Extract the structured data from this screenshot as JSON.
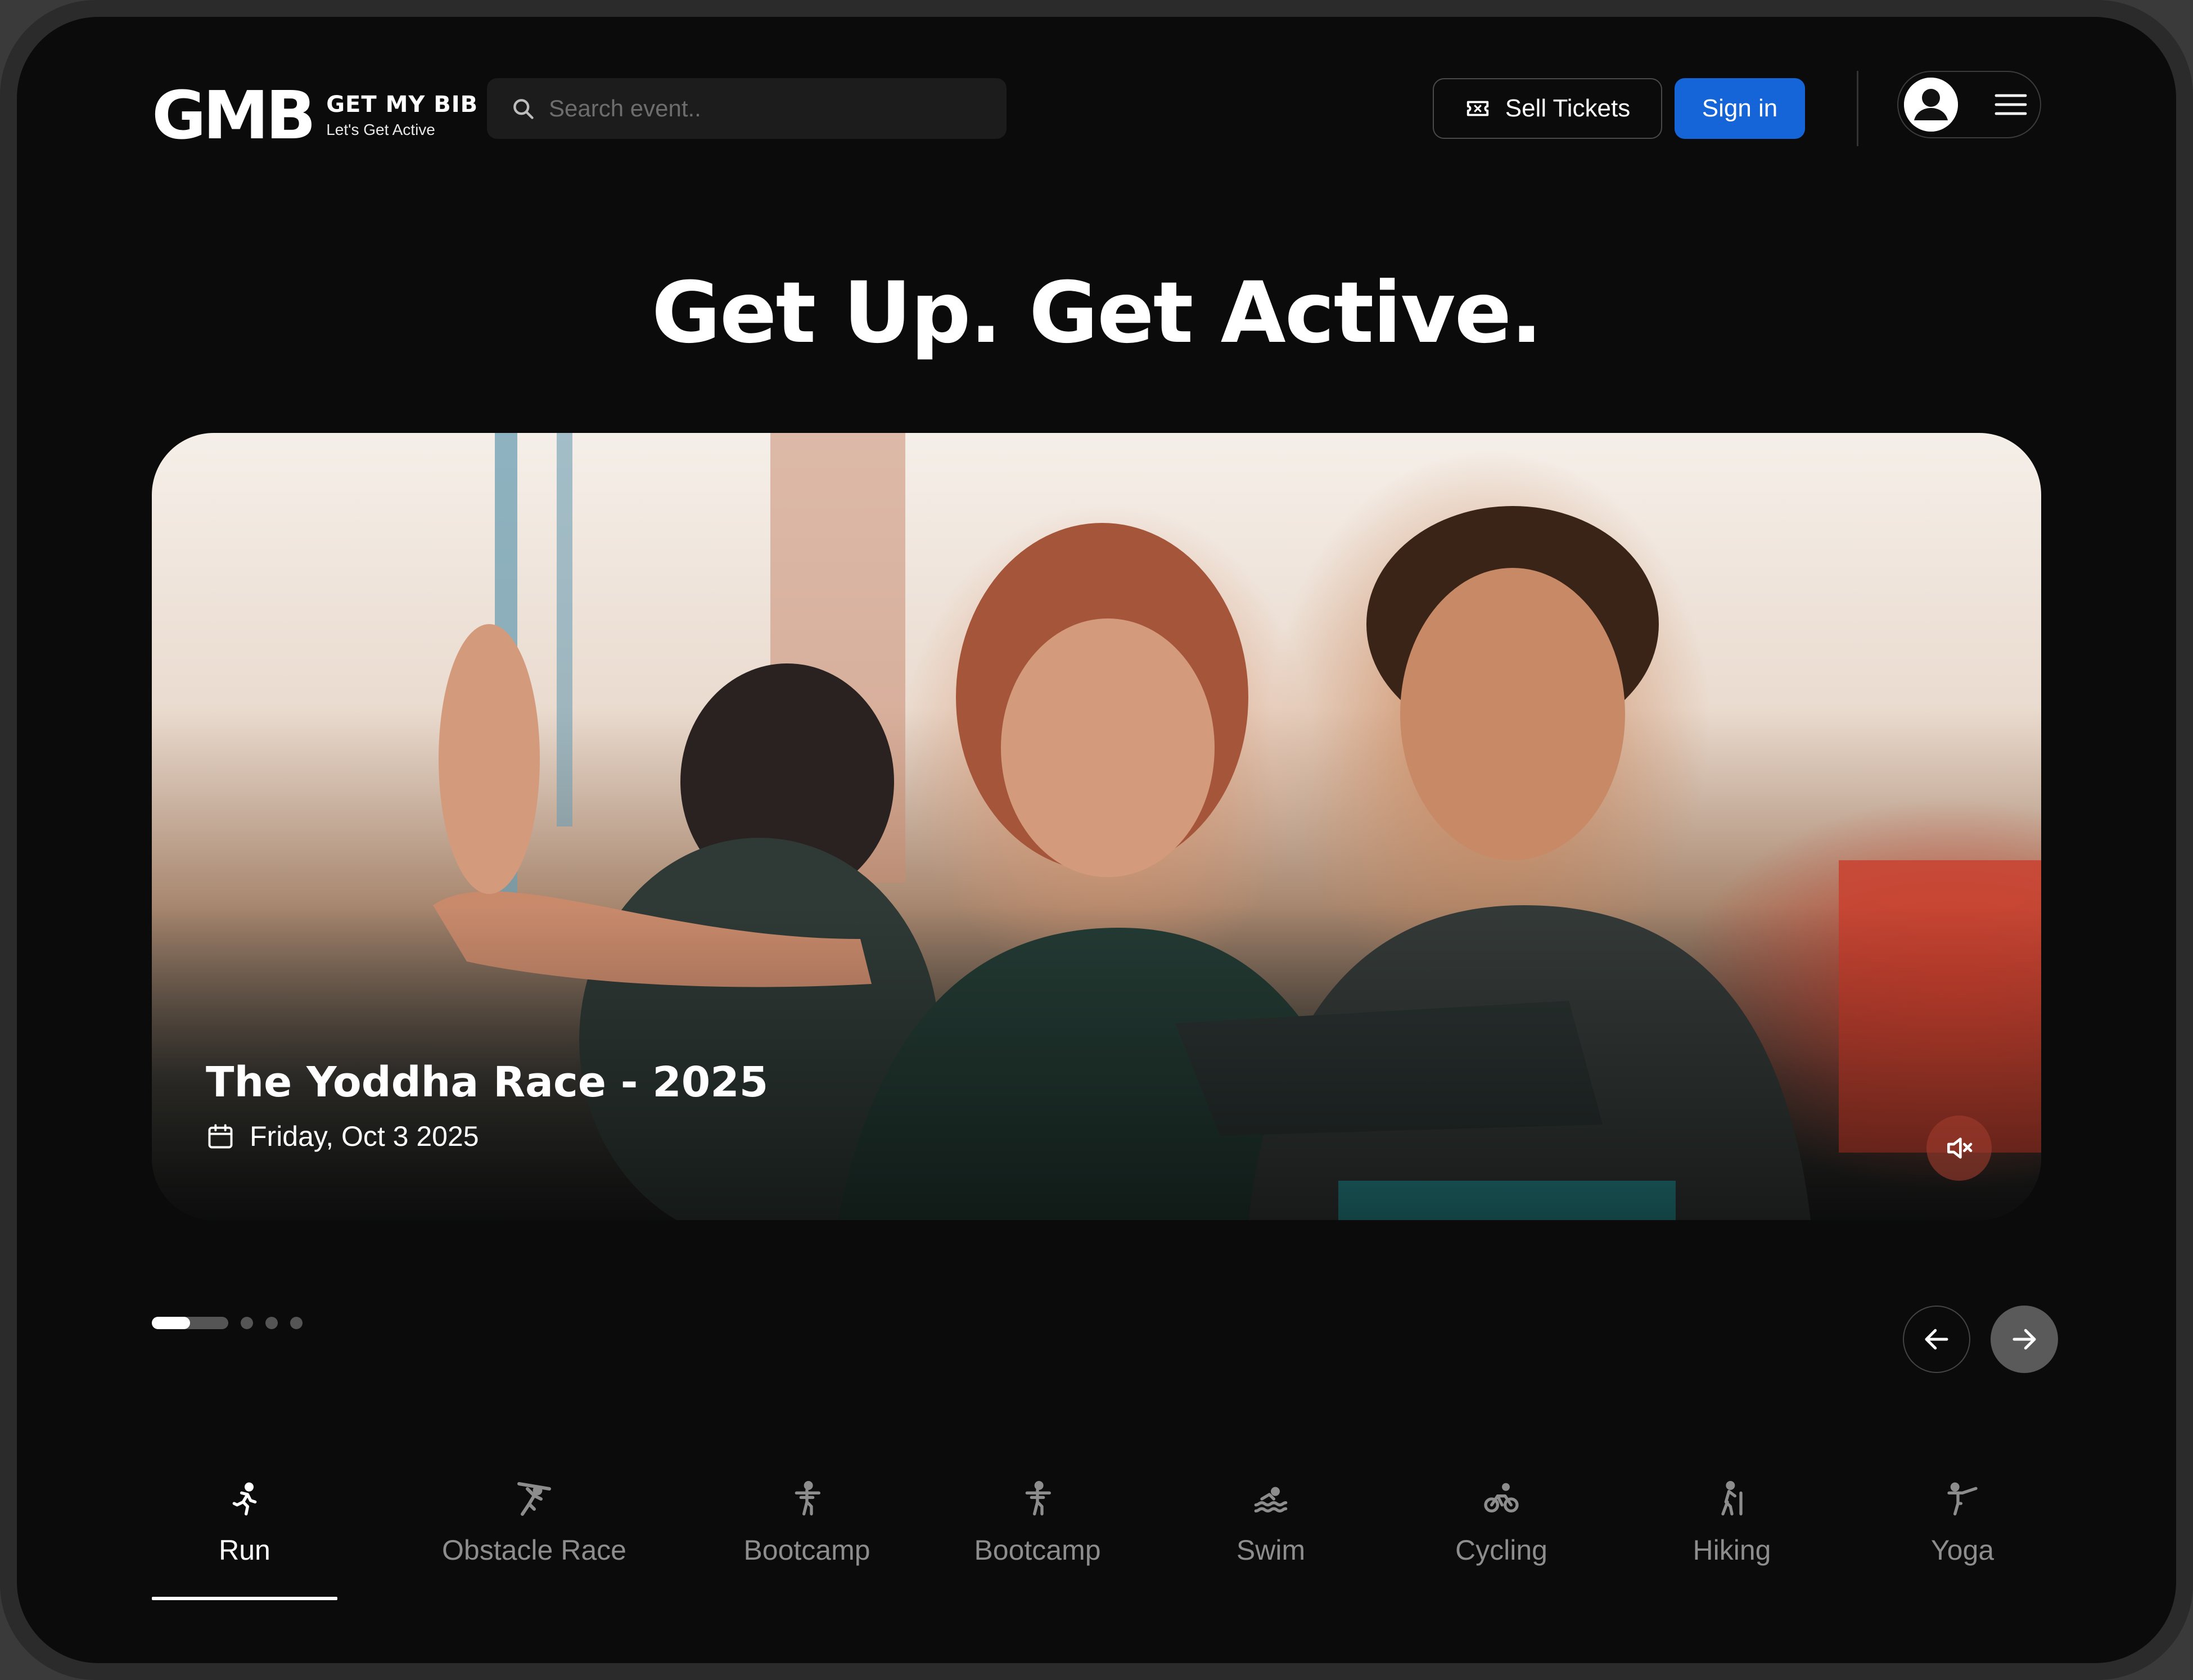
{
  "header": {
    "logo_mark": "GMB",
    "logo_name": "GET MY BIB",
    "logo_tagline": "Let's Get Active",
    "search_placeholder": "Search event..",
    "sell_tickets_label": "Sell Tickets",
    "sign_in_label": "Sign in"
  },
  "hero": {
    "title": "Get Up. Get Active."
  },
  "banner": {
    "event_title": "The Yoddha Race - 2025",
    "event_date": "Friday, Oct 3 2025",
    "muted": true
  },
  "carousel": {
    "slide_count": 4,
    "active_index": 0,
    "progress": 0.5
  },
  "categories": {
    "active": "Run",
    "items": [
      {
        "label": "Run",
        "icon": "run-icon"
      },
      {
        "label": "Obstacle Race",
        "icon": "obstacle-icon"
      },
      {
        "label": "Bootcamp",
        "icon": "bootcamp-icon"
      },
      {
        "label": "Bootcamp",
        "icon": "bootcamp-icon"
      },
      {
        "label": "Swim",
        "icon": "swim-icon"
      },
      {
        "label": "Cycling",
        "icon": "cycling-icon"
      },
      {
        "label": "Hiking",
        "icon": "hiking-icon"
      },
      {
        "label": "Yoga",
        "icon": "yoga-icon"
      }
    ]
  },
  "colors": {
    "background": "#0b0b0b",
    "accent": "#1565d8",
    "text": "#ffffff",
    "muted_text": "#8d8d8d"
  }
}
